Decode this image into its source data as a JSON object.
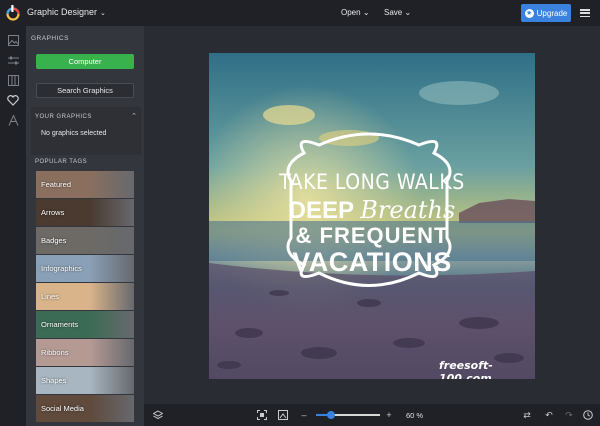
{
  "app": {
    "title": "Graphic Designer",
    "menus": {
      "open": "Open",
      "save": "Save"
    },
    "upgrade_label": "Upgrade"
  },
  "rail": {
    "icons": [
      "image-icon",
      "sliders-icon",
      "columns-icon",
      "heart-icon",
      "text-icon"
    ],
    "help_label": "?"
  },
  "panel": {
    "heading": "GRAPHICS",
    "computer_button": "Computer",
    "search_button": "Search Graphics",
    "your_graphics_heading": "YOUR GRAPHICS",
    "your_graphics_empty": "No graphics selected",
    "popular_tags_heading": "POPULAR TAGS",
    "tags": [
      {
        "label": "Featured",
        "color": "#8a6f5e"
      },
      {
        "label": "Arrows",
        "color": "#4a3a30"
      },
      {
        "label": "Badges",
        "color": "#6d6a66"
      },
      {
        "label": "Infographics",
        "color": "#8aa0b6"
      },
      {
        "label": "Lines",
        "color": "#d9b48a"
      },
      {
        "label": "Ornaments",
        "color": "#3c6b55"
      },
      {
        "label": "Ribbons",
        "color": "#b59a94"
      },
      {
        "label": "Shapes",
        "color": "#a7b6c0"
      },
      {
        "label": "Social Media",
        "color": "#5f4a3c"
      }
    ]
  },
  "artboard": {
    "line1": "TAKE LONG WALKS",
    "line2a": "DEEP",
    "line2b": "Breaths",
    "line3": "& FREQUENT",
    "line4": "VACATIONS",
    "watermark": "freesoft-100.com"
  },
  "bottombar": {
    "zoom_label": "60 %",
    "zoom_fraction": 0.6
  },
  "colors": {
    "accent": "#3b82e0",
    "computer_button": "#37b24d",
    "topbar": "#1f2126",
    "panel": "#34363d"
  }
}
